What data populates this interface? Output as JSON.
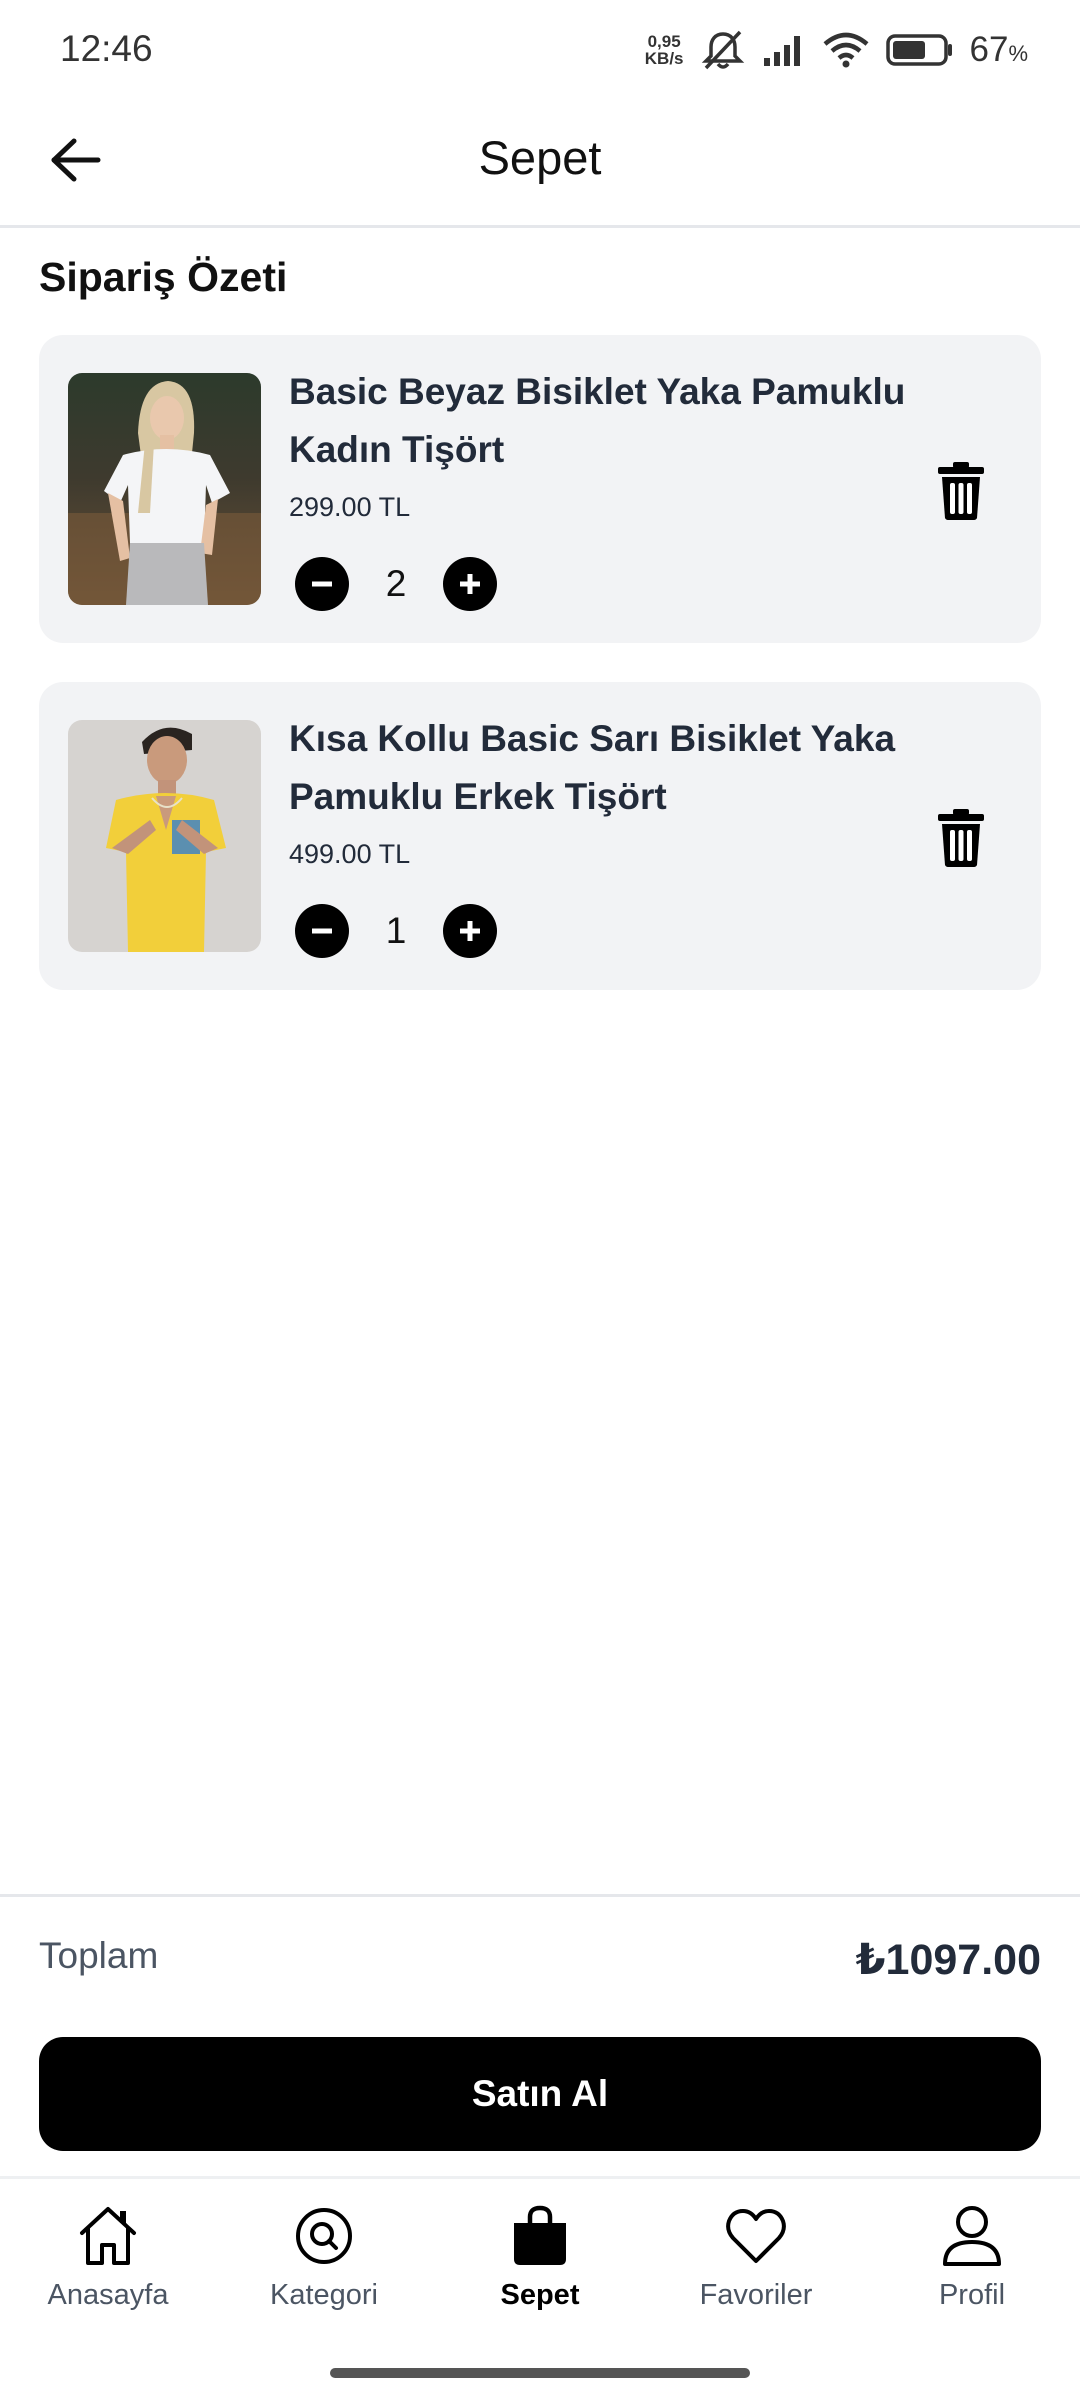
{
  "status_bar": {
    "time": "12:46",
    "net_speed_value": "0,95",
    "net_speed_unit": "KB/s",
    "battery_level": "67",
    "battery_unit": "%",
    "battery_fill": 0.67
  },
  "header": {
    "title": "Sepet",
    "back_icon": "arrow-left-icon"
  },
  "section_title": "Sipariş Özeti",
  "cart": {
    "items": [
      {
        "name": "Basic Beyaz Bisiklet Yaka Pamuklu Kadın Tişört",
        "price": "299.00 TL",
        "quantity": "2",
        "image": "woman-white-tshirt"
      },
      {
        "name": "Kısa Kollu Basic Sarı Bisiklet Yaka Pamuklu Erkek Tişört",
        "price": "499.00 TL",
        "quantity": "1",
        "image": "man-yellow-tshirt"
      }
    ]
  },
  "summary": {
    "total_label": "Toplam",
    "total_value": "₺1097.00",
    "buy_label": "Satın Al"
  },
  "nav": {
    "items": [
      {
        "label": "Anasayfa",
        "icon": "home-icon",
        "active": false
      },
      {
        "label": "Kategori",
        "icon": "search-circle-icon",
        "active": false
      },
      {
        "label": "Sepet",
        "icon": "shopping-bag-icon",
        "active": true
      },
      {
        "label": "Favoriler",
        "icon": "heart-icon",
        "active": false
      },
      {
        "label": "Profil",
        "icon": "user-icon",
        "active": false
      }
    ]
  },
  "colors": {
    "accent": "#000000",
    "card_background": "#f2f3f5",
    "text_primary": "#222b3a"
  }
}
